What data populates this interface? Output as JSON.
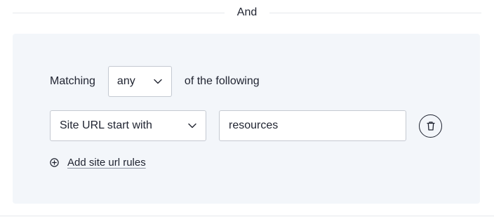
{
  "header": {
    "divider_label": "And"
  },
  "condition": {
    "matching_label": "Matching",
    "match_select_value": "any",
    "match_suffix": "of the following"
  },
  "rule": {
    "type_select_value": "Site URL start with",
    "value_input": "resources"
  },
  "actions": {
    "add_rule_label": "Add site url rules"
  },
  "icons": {
    "match_chevron": "chevron-down-icon",
    "rule_chevron": "chevron-down-icon",
    "delete": "trash-icon",
    "add": "plus-circle-icon"
  },
  "colors": {
    "panel_bg": "#f3f6fa",
    "border": "#c4c9d1",
    "text": "#1f2330"
  }
}
